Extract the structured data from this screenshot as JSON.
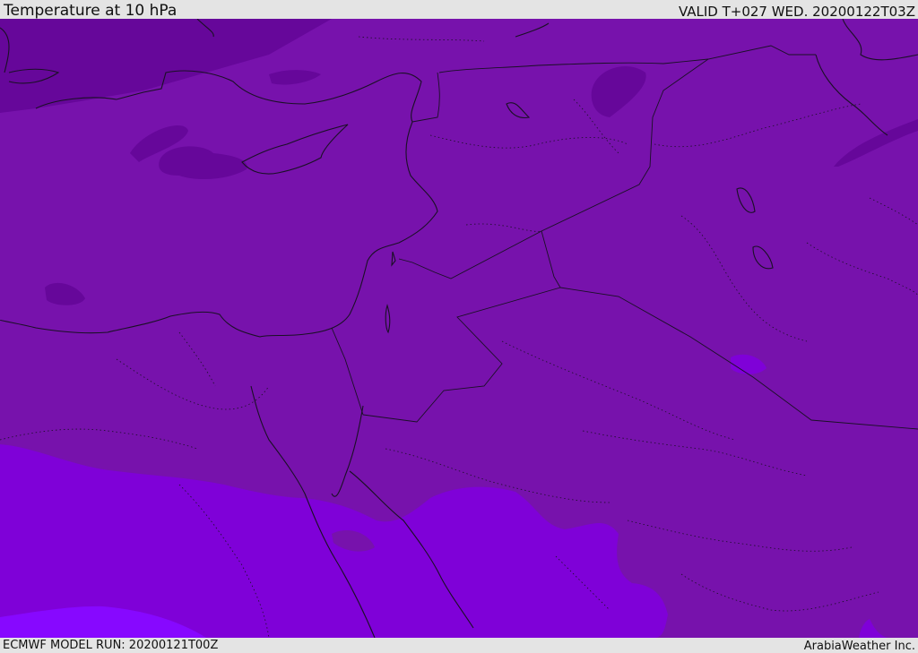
{
  "header": {
    "title": "Temperature at 10 hPa",
    "valid": "VALID T+027 WED. 20200122T03Z"
  },
  "footer": {
    "model_run": "ECMWF MODEL RUN: 20200121T00Z",
    "credit": "ArabiaWeather Inc."
  },
  "map": {
    "variable": "temperature",
    "level": "10 hPa",
    "region": "Eastern Mediterranean / Middle East",
    "colors": {
      "main_field": "#7712ac",
      "colder_field": "#66079a",
      "warmer_field": "#7f01d8",
      "warmest_field": "#8708ff",
      "coastline": "#1a1025"
    }
  }
}
